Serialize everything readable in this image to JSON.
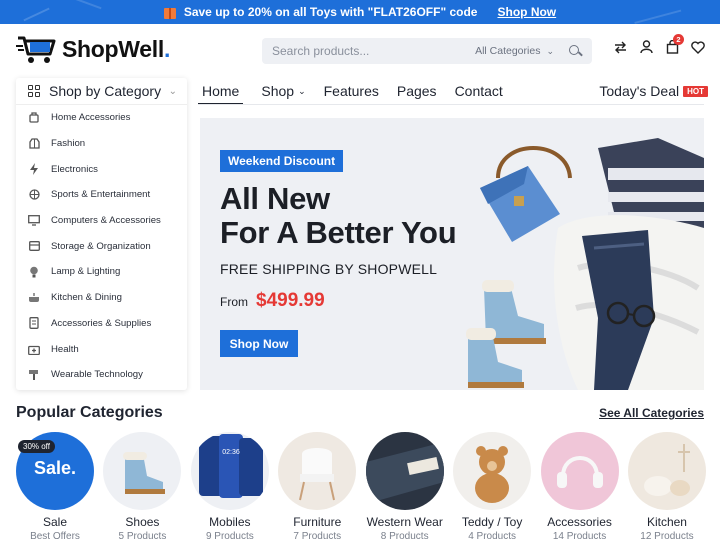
{
  "promo": {
    "text": "Save up to 20% on all Toys with \"FLAT26OFF\" code",
    "link": "Shop Now",
    "gift_icon": "gift-icon"
  },
  "header": {
    "brand": "ShopWell",
    "brand_dot": ".",
    "search_placeholder": "Search products...",
    "search_category": "All Categories",
    "cart_count": "2",
    "icons": [
      "compare-icon",
      "user-icon",
      "cart-icon",
      "heart-icon"
    ]
  },
  "sidebar": {
    "title": "Shop by Category",
    "items": [
      {
        "label": "Home Accessories",
        "icon": "home-accessories-icon"
      },
      {
        "label": "Fashion",
        "icon": "fashion-icon"
      },
      {
        "label": "Electronics",
        "icon": "electronics-icon"
      },
      {
        "label": "Sports & Entertainment",
        "icon": "sports-icon"
      },
      {
        "label": "Computers & Accessories",
        "icon": "computer-icon"
      },
      {
        "label": "Storage & Organization",
        "icon": "storage-icon"
      },
      {
        "label": "Lamp & Lighting",
        "icon": "lamp-icon"
      },
      {
        "label": "Kitchen & Dining",
        "icon": "kitchen-icon"
      },
      {
        "label": "Accessories & Supplies",
        "icon": "supplies-icon"
      },
      {
        "label": "Health",
        "icon": "health-icon"
      },
      {
        "label": "Wearable Technology",
        "icon": "wearable-icon"
      }
    ]
  },
  "nav": {
    "items": [
      "Home",
      "Shop",
      "Features",
      "Pages",
      "Contact"
    ],
    "deal": "Today's Deal",
    "hot": "HOT"
  },
  "hero": {
    "tag": "Weekend Discount",
    "title_line1": "All New",
    "title_line2": "For A Better You",
    "subtitle": "FREE SHIPPING BY SHOPWELL",
    "from_label": "From",
    "price": "$499.99",
    "button": "Shop Now"
  },
  "popular": {
    "title": "Popular Categories",
    "see_all": "See All Categories",
    "categories": [
      {
        "name": "Sale",
        "count": "Best Offers",
        "badge": "30% off",
        "circle_text": "Sale."
      },
      {
        "name": "Shoes",
        "count": "5 Products"
      },
      {
        "name": "Mobiles",
        "count": "9 Products"
      },
      {
        "name": "Furniture",
        "count": "7 Products"
      },
      {
        "name": "Western Wear",
        "count": "8 Products"
      },
      {
        "name": "Teddy / Toy",
        "count": "4 Products"
      },
      {
        "name": "Accessories",
        "count": "14 Products"
      },
      {
        "name": "Kitchen",
        "count": "12 Products"
      }
    ]
  },
  "colors": {
    "accent": "#1e6fd9",
    "price_red": "#e53935",
    "hero_bg": "#eef0f4"
  }
}
